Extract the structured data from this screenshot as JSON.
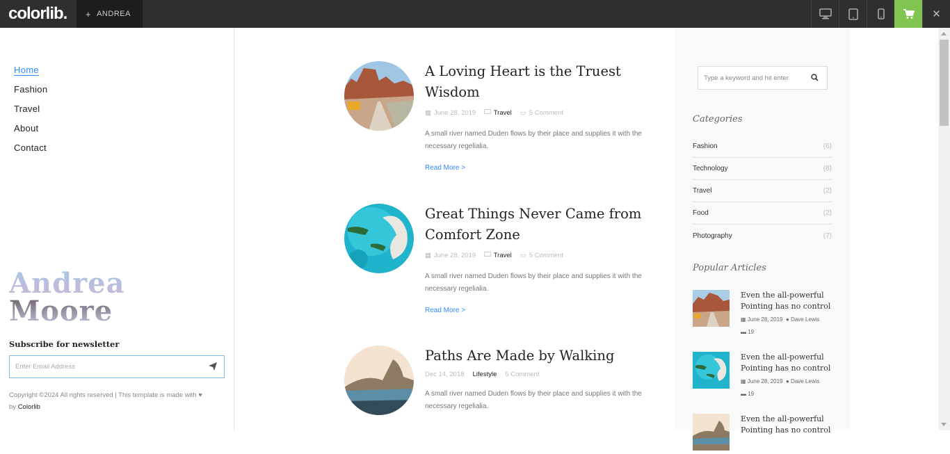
{
  "topbar": {
    "logo": "colorlib",
    "logo_dot": ".",
    "theme_tab": "ANDREA",
    "theme_tab_icon": "plus-icon",
    "buttons": [
      "desktop-icon",
      "tablet-icon",
      "mobile-icon",
      "cart-icon",
      "close-icon"
    ],
    "cart_color": "#82c452"
  },
  "nav": {
    "items": [
      "Home",
      "Fashion",
      "Travel",
      "About",
      "Contact"
    ],
    "active": "Home"
  },
  "brand": {
    "line1": "Andrea",
    "line2": "Moore"
  },
  "newsletter": {
    "title": "Subscribe for newsletter",
    "placeholder": "Enter Email Address"
  },
  "footer": {
    "copyright": "Copyright ©2024 All rights reserved | This template is made with ♥",
    "by_prefix": "by",
    "by_link": "Colorlib"
  },
  "posts": [
    {
      "title": "A Loving Heart is the Truest Wisdom",
      "date": "June 28, 2019",
      "category": "Travel",
      "comments": "5 Comment",
      "excerpt": "A small river named Duden flows by their place and supplies it with the necessary regelialia.",
      "read_more": "Read More >"
    },
    {
      "title": "Great Things Never Came from Comfort Zone",
      "date": "June 28, 2019",
      "category": "Travel",
      "comments": "5 Comment",
      "excerpt": "A small river named Duden flows by their place and supplies it with the necessary regelialia.",
      "read_more": "Read More >"
    },
    {
      "title": "Paths Are Made by Walking",
      "date": "Dec 14, 2018",
      "category": "Lifestyle",
      "comments": "5 Comment",
      "excerpt": "A small river named Duden flows by their place and supplies it with the necessary regelialia."
    }
  ],
  "sidebar": {
    "search_placeholder": "Type a keyword and hit enter",
    "categories_title": "Categories",
    "categories": [
      {
        "name": "Fashion",
        "count": "(6)"
      },
      {
        "name": "Technology",
        "count": "(8)"
      },
      {
        "name": "Travel",
        "count": "(2)"
      },
      {
        "name": "Food",
        "count": "(2)"
      },
      {
        "name": "Photography",
        "count": "(7)"
      }
    ],
    "popular_title": "Popular Articles",
    "popular": [
      {
        "title": "Even the all-powerful Pointing has no control",
        "date": "June 28, 2019",
        "author": "Dave Lewis",
        "comments": "19"
      },
      {
        "title": "Even the all-powerful Pointing has no control",
        "date": "June 28, 2019",
        "author": "Dave Lewis",
        "comments": "19"
      },
      {
        "title": "Even the all-powerful Pointing has no control"
      }
    ]
  },
  "accent_color": "#2f89fc"
}
